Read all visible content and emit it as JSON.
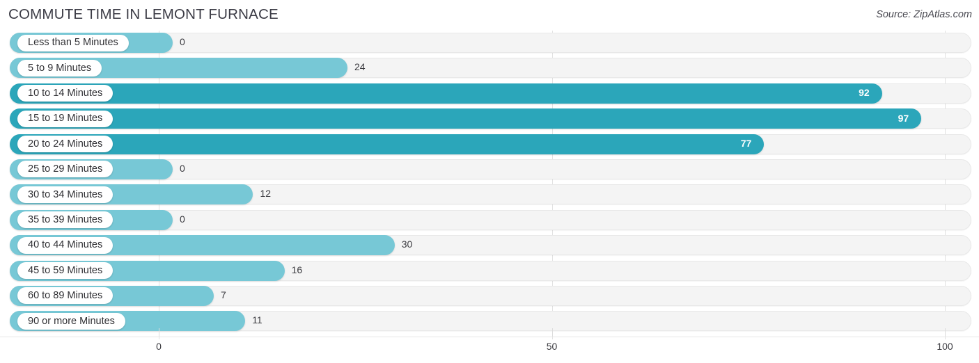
{
  "header": {
    "title": "COMMUTE TIME IN LEMONT FURNACE",
    "source": "Source: ZipAtlas.com"
  },
  "colors": {
    "bar_light": "#77c8d6",
    "bar_dark": "#2ba6ba",
    "track": "#f4f4f4",
    "gridline": "#e2e2e2",
    "text": "#3a3a3f"
  },
  "chart_data": {
    "type": "bar",
    "orientation": "horizontal",
    "title": "COMMUTE TIME IN LEMONT FURNACE",
    "xlabel": "",
    "ylabel": "",
    "xlim": [
      0,
      100
    ],
    "xticks": [
      0,
      50,
      100
    ],
    "xtick_labels": [
      "0",
      "50",
      "100"
    ],
    "grid": true,
    "legend": null,
    "categories": [
      "Less than 5 Minutes",
      "5 to 9 Minutes",
      "10 to 14 Minutes",
      "15 to 19 Minutes",
      "20 to 24 Minutes",
      "25 to 29 Minutes",
      "30 to 34 Minutes",
      "35 to 39 Minutes",
      "40 to 44 Minutes",
      "45 to 59 Minutes",
      "60 to 89 Minutes",
      "90 or more Minutes"
    ],
    "values": [
      0,
      24,
      92,
      97,
      77,
      0,
      12,
      0,
      30,
      16,
      7,
      11
    ],
    "value_labels": [
      "0",
      "24",
      "92",
      "97",
      "77",
      "0",
      "12",
      "0",
      "30",
      "16",
      "7",
      "11"
    ]
  },
  "rows": [
    {
      "label": "Less than 5 Minutes",
      "value": 0,
      "value_label": "0",
      "shade": "light",
      "label_inside": false
    },
    {
      "label": "5 to 9 Minutes",
      "value": 24,
      "value_label": "24",
      "shade": "light",
      "label_inside": false
    },
    {
      "label": "10 to 14 Minutes",
      "value": 92,
      "value_label": "92",
      "shade": "dark",
      "label_inside": true
    },
    {
      "label": "15 to 19 Minutes",
      "value": 97,
      "value_label": "97",
      "shade": "dark",
      "label_inside": true
    },
    {
      "label": "20 to 24 Minutes",
      "value": 77,
      "value_label": "77",
      "shade": "dark",
      "label_inside": true
    },
    {
      "label": "25 to 29 Minutes",
      "value": 0,
      "value_label": "0",
      "shade": "light",
      "label_inside": false
    },
    {
      "label": "30 to 34 Minutes",
      "value": 12,
      "value_label": "12",
      "shade": "light",
      "label_inside": false
    },
    {
      "label": "35 to 39 Minutes",
      "value": 0,
      "value_label": "0",
      "shade": "light",
      "label_inside": false
    },
    {
      "label": "40 to 44 Minutes",
      "value": 30,
      "value_label": "30",
      "shade": "light",
      "label_inside": false
    },
    {
      "label": "45 to 59 Minutes",
      "value": 16,
      "value_label": "16",
      "shade": "light",
      "label_inside": false
    },
    {
      "label": "60 to 89 Minutes",
      "value": 7,
      "value_label": "7",
      "shade": "light",
      "label_inside": false
    },
    {
      "label": "90 or more Minutes",
      "value": 11,
      "value_label": "11",
      "shade": "light",
      "label_inside": false
    }
  ],
  "axis": {
    "ticks": [
      {
        "label": "0",
        "value": 0
      },
      {
        "label": "50",
        "value": 50
      },
      {
        "label": "100",
        "value": 100
      }
    ]
  }
}
